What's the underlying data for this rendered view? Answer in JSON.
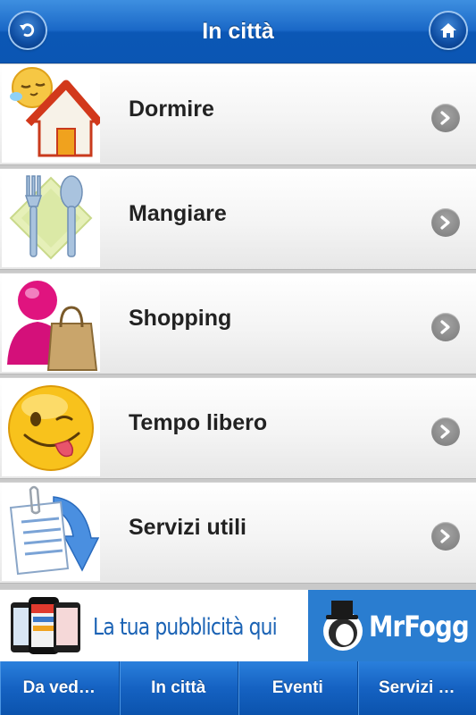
{
  "header": {
    "title": "In città",
    "back_icon": "back-arrow-icon",
    "home_icon": "home-icon"
  },
  "menu": {
    "items": [
      {
        "label": "Dormire",
        "icon": "sleeping-house-icon"
      },
      {
        "label": "Mangiare",
        "icon": "fork-spoon-plate-icon"
      },
      {
        "label": "Shopping",
        "icon": "shopper-bag-icon"
      },
      {
        "label": "Tempo libero",
        "icon": "winking-smiley-icon"
      },
      {
        "label": "Servizi utili",
        "icon": "document-arrow-icon"
      }
    ],
    "chevron_icon": "chevron-right-icon"
  },
  "ad": {
    "text": "La tua pubblicità qui",
    "brand": "MrFogg"
  },
  "tabs": [
    {
      "label": "Da ved…"
    },
    {
      "label": "In città"
    },
    {
      "label": "Eventi"
    },
    {
      "label": "Servizi …"
    }
  ],
  "colors": {
    "header_blue": "#1a68c7",
    "tab_blue": "#1562c2",
    "label_text": "#222222",
    "ad_text": "#1b63b5"
  }
}
